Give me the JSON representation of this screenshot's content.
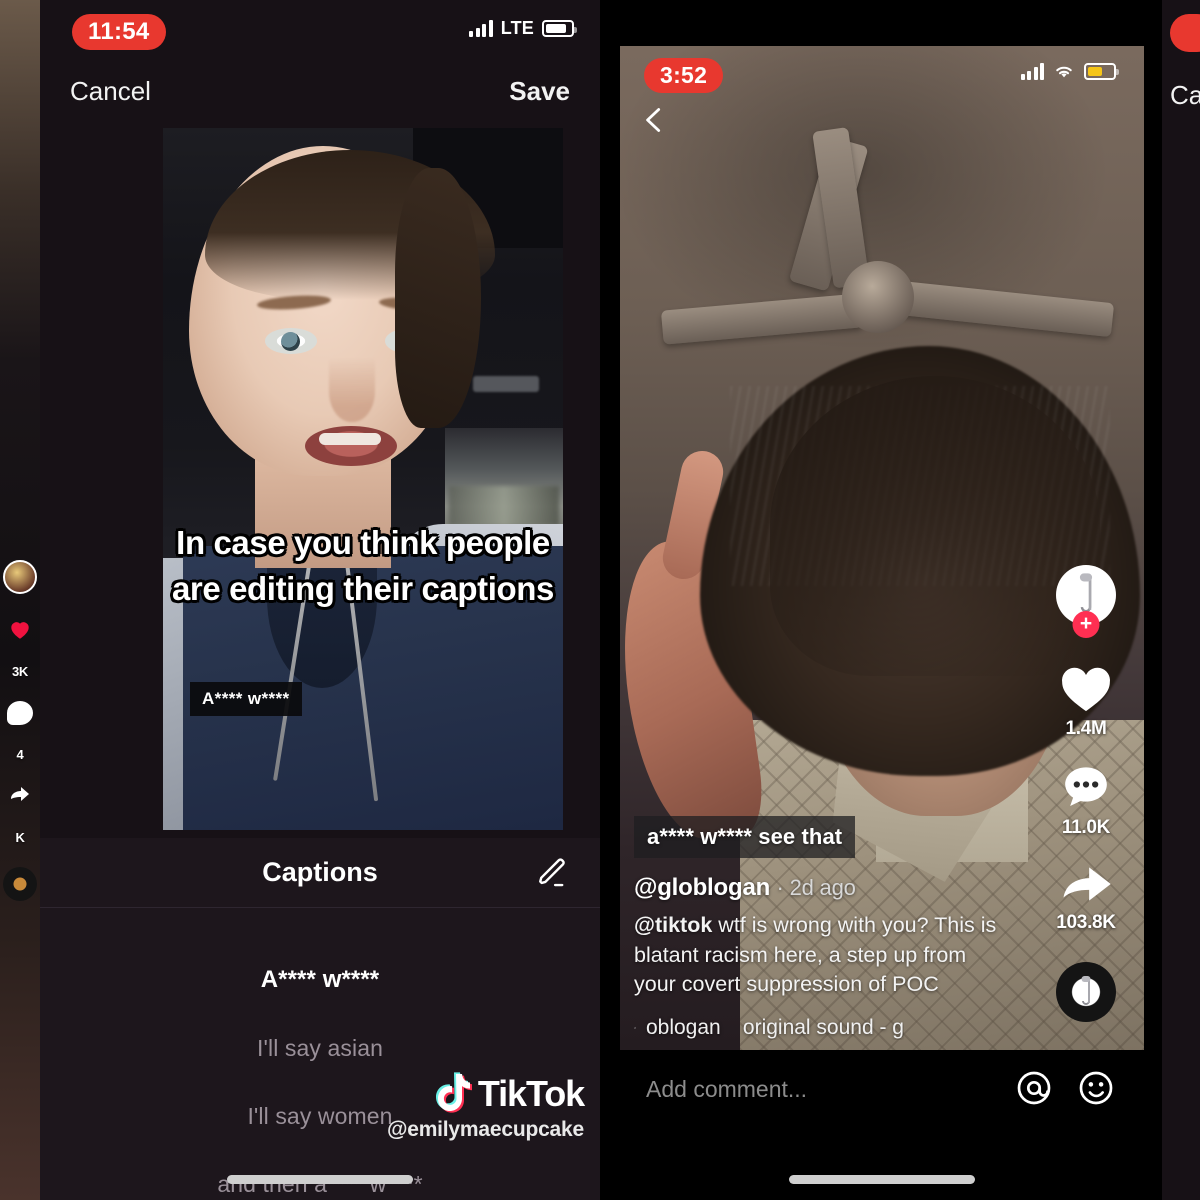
{
  "left_sliver": {
    "name": "partial-tiktok-feed",
    "likes": "3K",
    "comments": "4",
    "shares": "K"
  },
  "left_phone": {
    "status_bar": {
      "time": "11:54",
      "network": "LTE",
      "signal_icon": "cellular-bars-icon",
      "battery_icon": "battery-icon",
      "battery_color": "#ffffff",
      "time_pill_color": "#e8382f"
    },
    "nav": {
      "cancel_label": "Cancel",
      "save_label": "Save"
    },
    "video": {
      "overlay_caption_line1": "In case you think people",
      "overlay_caption_line2": "are editing their captions",
      "caption_chip": "A**** w****"
    },
    "captions_panel": {
      "title": "Captions",
      "edit_icon": "pencil-icon",
      "lines": [
        {
          "text": "A**** w****",
          "active": true
        },
        {
          "text": "I'll say asian",
          "active": false
        },
        {
          "text": "I'll say women",
          "active": false
        },
        {
          "text": "and then a**** w****",
          "active": false
        }
      ]
    },
    "watermark": {
      "logo_icon": "tiktok-note-icon",
      "brand": "TikTok",
      "handle": "@emilymaecupcake"
    }
  },
  "mid_phone": {
    "status_bar": {
      "time": "3:52",
      "signal_icon": "cellular-bars-icon",
      "wifi_icon": "wifi-icon",
      "battery_icon": "battery-low-power-icon",
      "battery_color": "#f5c518",
      "time_pill_color": "#e8382f"
    },
    "back_icon": "chevron-left-icon",
    "post": {
      "caption_chip": "a**** w**** see that",
      "author": "@globlogan",
      "posted_ago": "· 2d ago",
      "description_mention": "@tiktok",
      "description": " wtf is wrong with you? This is blatant racism here, a step up from your covert suppression of POC",
      "sound_icon": "music-note-icon",
      "sound_author": "oblogan",
      "sound_title": "original sound - g"
    },
    "rail": {
      "avatar_icon": "safety-pin-avatar",
      "follow_label": "+",
      "like_icon": "heart-icon",
      "like_count": "1.4M",
      "comment_icon": "comment-bubble-icon",
      "comment_count": "11.0K",
      "share_icon": "share-arrow-icon",
      "share_count": "103.8K",
      "disc_icon": "record-disc-icon"
    },
    "comment_bar": {
      "placeholder": "Add comment...",
      "mention_icon": "at-mention-icon",
      "emoji_icon": "emoji-smiley-icon"
    }
  },
  "right_sliver": {
    "cancel_label": "Ca",
    "time_pill_color": "#e8382f"
  }
}
